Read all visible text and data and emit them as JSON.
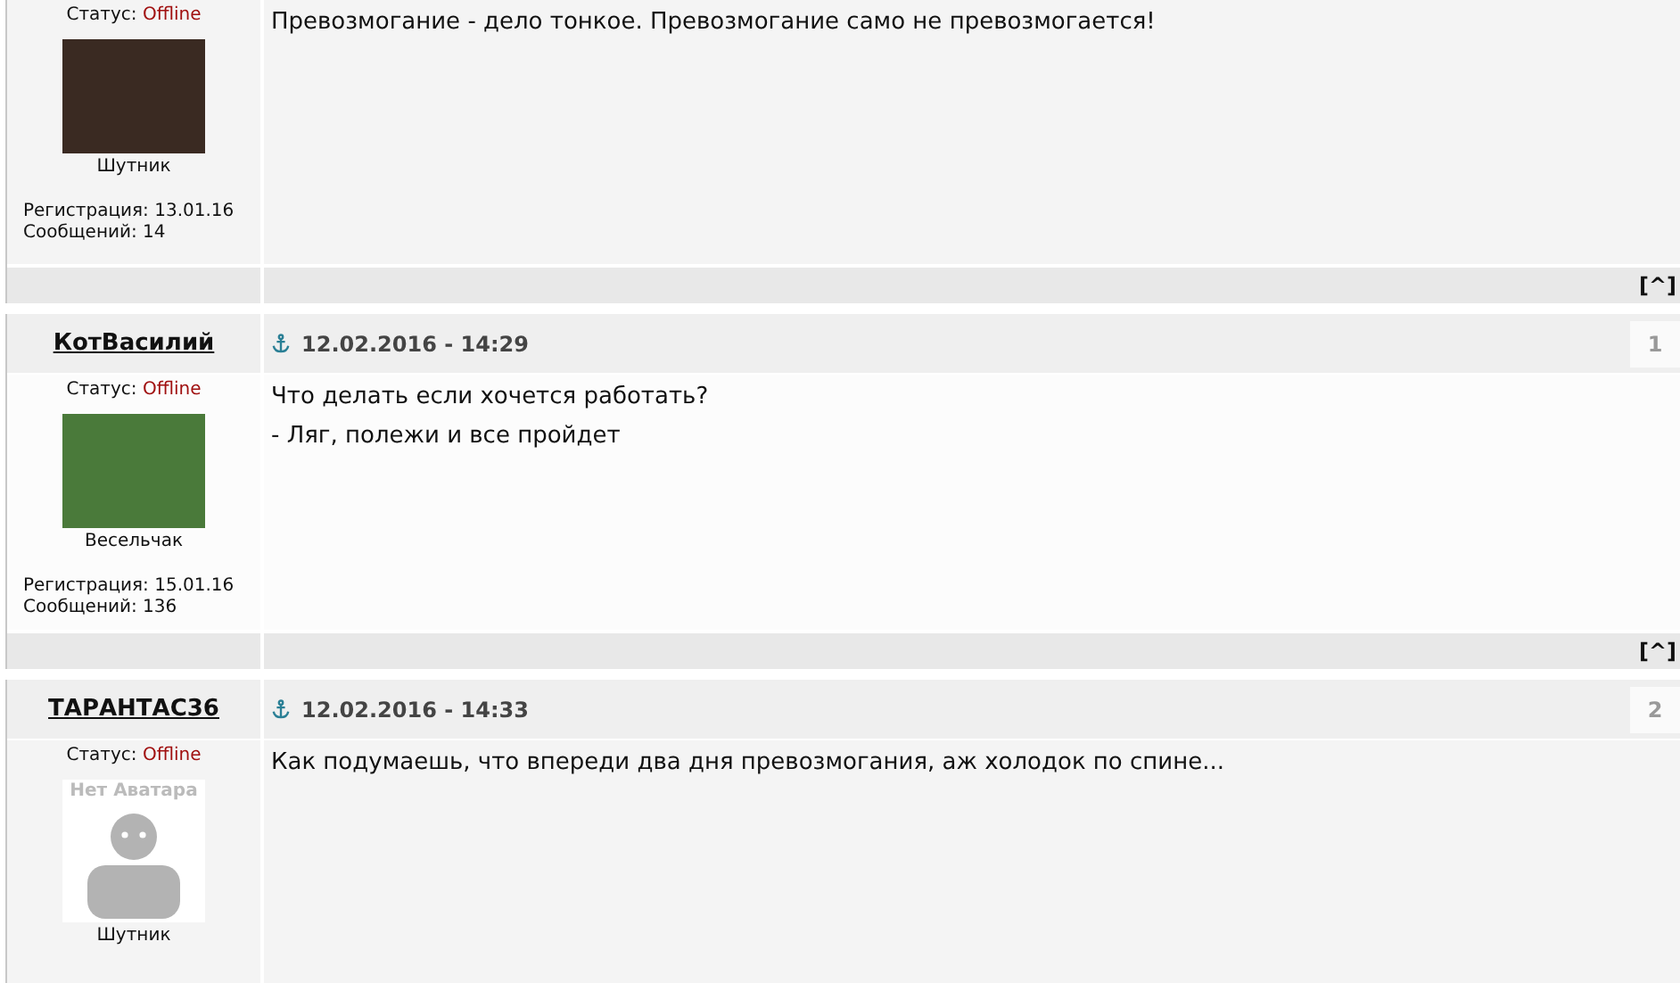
{
  "posts": [
    {
      "status_label": "Статус:",
      "status": "Offline",
      "avatar": {
        "kind": "photo"
      },
      "rank": "Шутник",
      "registration": "Регистрация: 13.01.16",
      "messages": "Сообщений: 14",
      "body": [
        "Превозмогание - дело тонкое. Превозмогание само не превозмогается!"
      ],
      "top_link": "[^]"
    },
    {
      "author": "КотВасилий",
      "date": "12.02.2016 - 14:29",
      "number": "1",
      "status_label": "Статус:",
      "status": "Offline",
      "avatar": {
        "kind": "photo"
      },
      "rank": "Весельчак",
      "registration": "Регистрация: 15.01.16",
      "messages": "Сообщений: 136",
      "body": [
        "Что делать если хочется работать?",
        "- Ляг, полежи и все пройдет"
      ],
      "top_link": "[^]"
    },
    {
      "author": "ТАРАНТАС36",
      "date": "12.02.2016 - 14:33",
      "number": "2",
      "status_label": "Статус:",
      "status": "Offline",
      "avatar": {
        "kind": "none",
        "caption": "Нет Аватара"
      },
      "rank": "Шутник",
      "body": [
        "Как подумаешь, что впереди два дня превозмогания, аж холодок по спине..."
      ]
    }
  ]
}
